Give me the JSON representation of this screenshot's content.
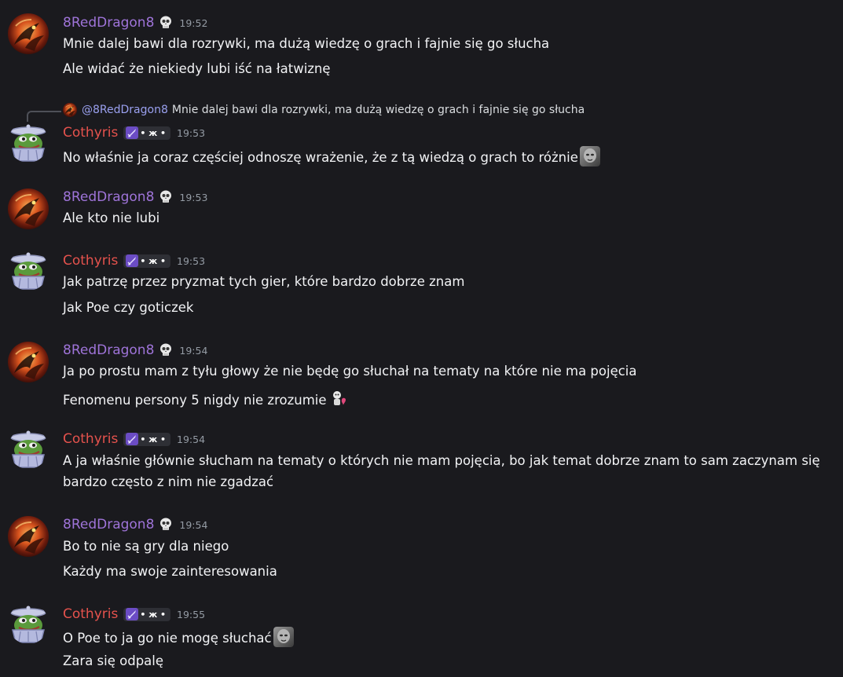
{
  "theme": {
    "background": "#1a1a1e",
    "dragon_name_color": "#9f74d9",
    "cothyris_name_color": "#e5524d",
    "mention_color": "#9aa0ef"
  },
  "users": {
    "dragon": {
      "name": "8RedDragon8",
      "badge_icon": "skull-emoji"
    },
    "cothyris": {
      "name": "Cothyris",
      "tag_text": "• ж •",
      "tag_icon": "sword-icon"
    }
  },
  "messages": [
    {
      "author": "8RedDragon8",
      "time": "19:52",
      "lines": [
        "Mnie dalej bawi dla rozrywki, ma dużą wiedzę o grach i fajnie się go słucha",
        "Ale widać że niekiedy lubi iść na łatwiznę"
      ]
    },
    {
      "author": "Cothyris",
      "time": "19:53",
      "reply": {
        "mention": "@8RedDragon8",
        "text": "Mnie dalej bawi dla rozrywki, ma dużą wiedzę o grach i fajnie się go słucha"
      },
      "lines": [
        "No właśnie ja coraz częściej odnoszę wrażenie, że z tą wiedzą o grach to różnie"
      ],
      "emoji": "grey-face-emoji"
    },
    {
      "author": "8RedDragon8",
      "time": "19:53",
      "lines": [
        "Ale kto nie lubi"
      ]
    },
    {
      "author": "Cothyris",
      "time": "19:53",
      "lines": [
        "Jak patrzę przez pryzmat tych gier, które bardzo dobrze znam",
        "Jak Poe czy goticzek"
      ]
    },
    {
      "author": "8RedDragon8",
      "time": "19:54",
      "lines": [
        "Ja po prostu mam z tyłu głowy że nie będę go słuchał na tematy na które nie ma pojęcia",
        "Fenomenu persony 5 nigdy nie zrozumie"
      ],
      "emoji": "heart-character-emoji"
    },
    {
      "author": "Cothyris",
      "time": "19:54",
      "lines": [
        "A ja właśnie głównie słucham na tematy o których nie mam pojęcia, bo jak temat dobrze znam to sam zaczynam się bardzo często z nim nie zgadzać"
      ]
    },
    {
      "author": "8RedDragon8",
      "time": "19:54",
      "lines": [
        "Bo to nie są gry dla niego",
        "Każdy ma swoje zainteresowania"
      ]
    },
    {
      "author": "Cothyris",
      "time": "19:55",
      "lines": [
        "O Poe to ja go nie mogę słuchać",
        "Zara się odpalę"
      ],
      "emoji": "grey-face-emoji"
    }
  ]
}
